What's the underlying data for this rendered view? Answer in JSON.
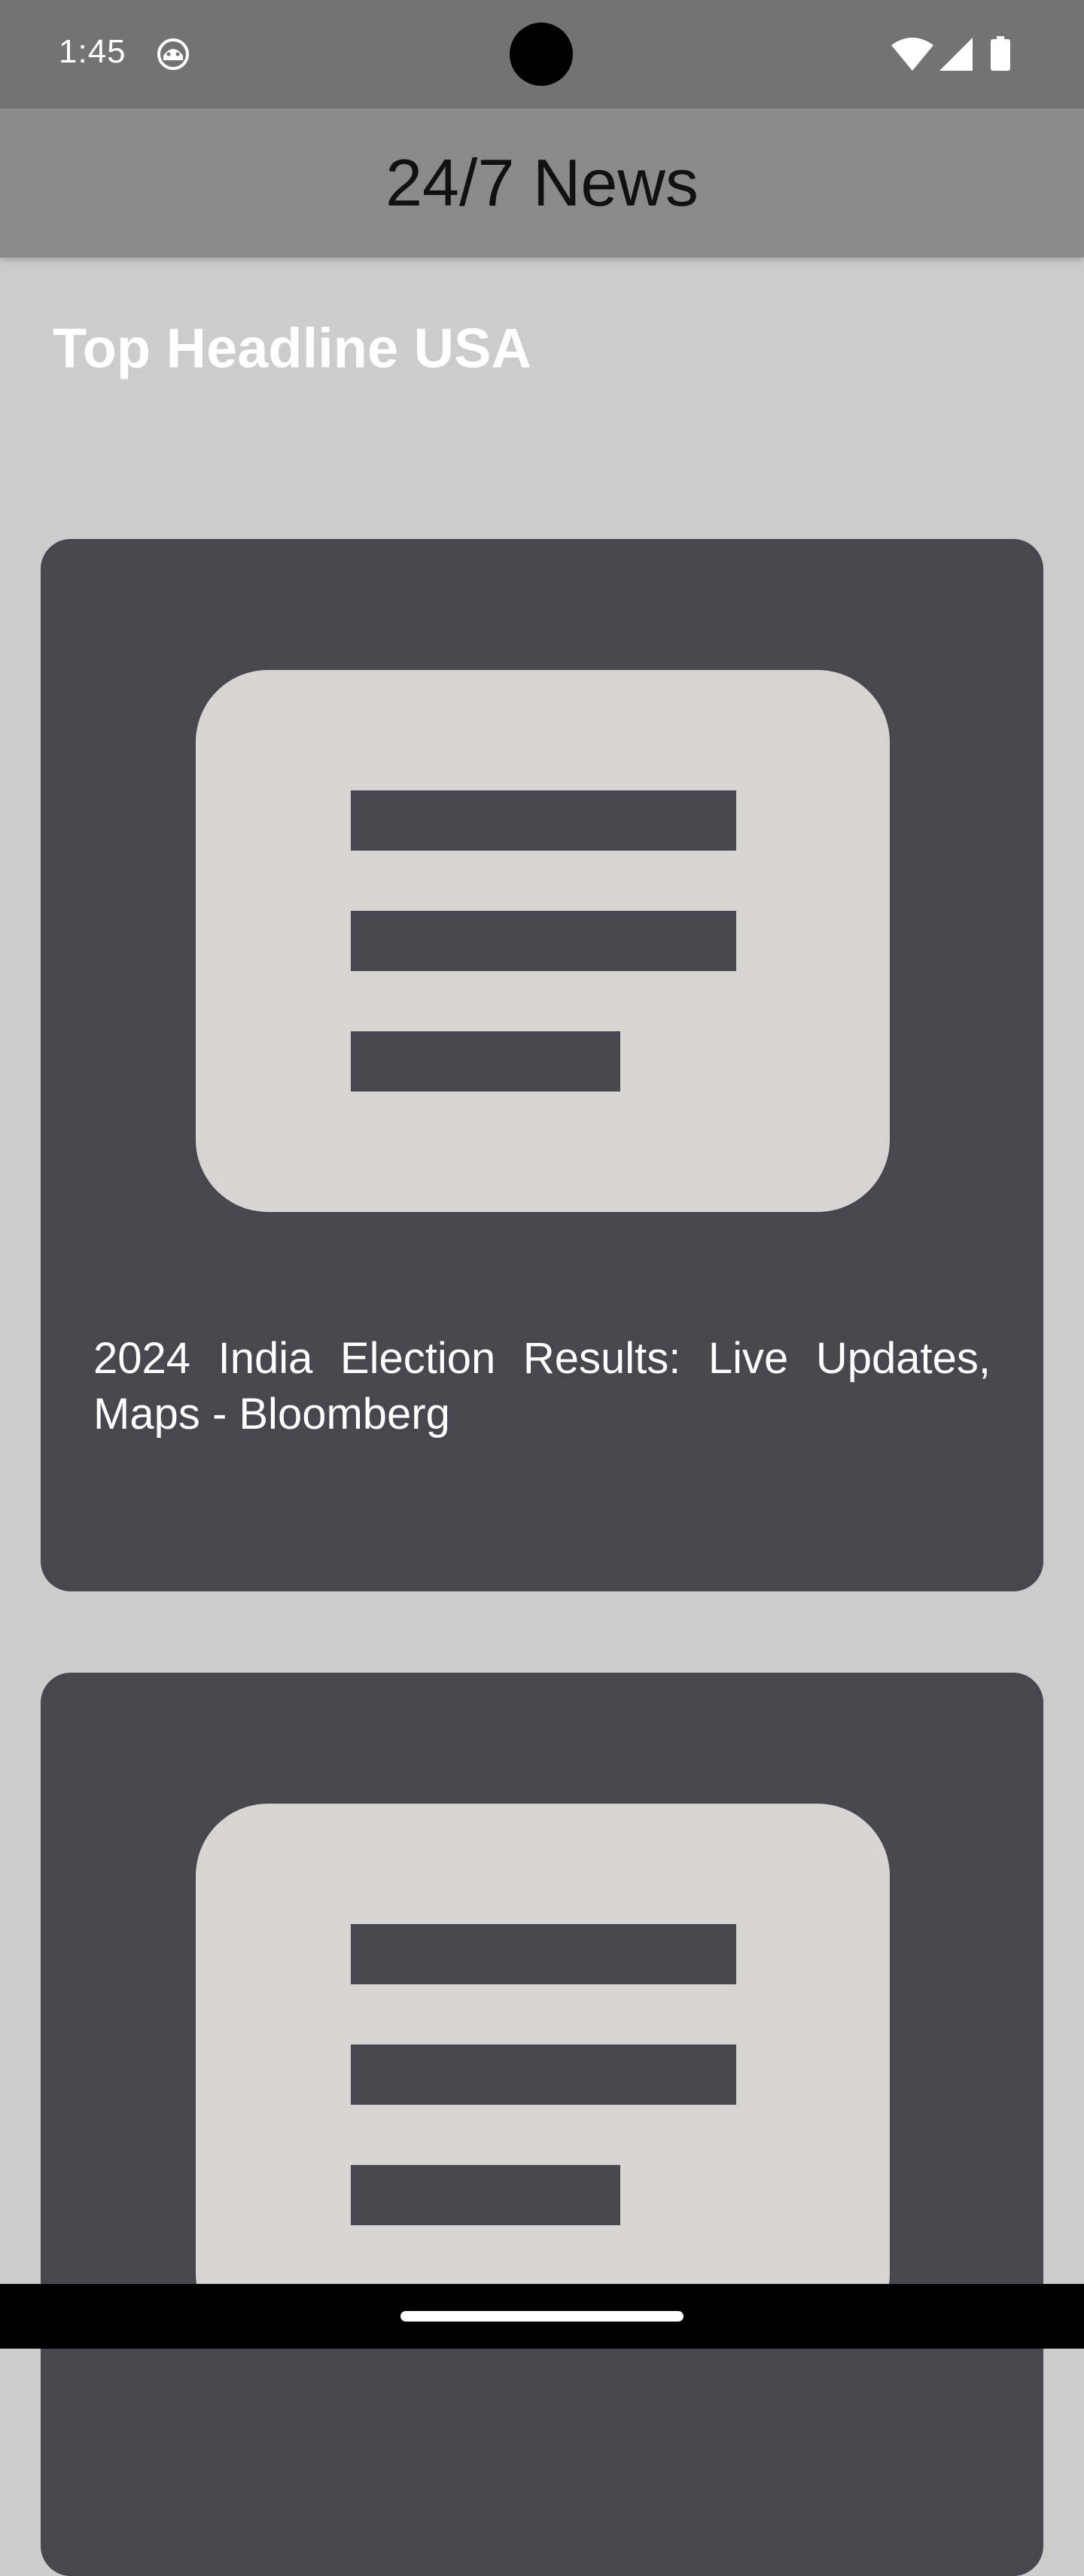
{
  "status_bar": {
    "time": "1:45",
    "app_icon": "android-bot-icon",
    "wifi_icon": "wifi-icon",
    "signal_icon": "cell-signal-icon",
    "battery_icon": "battery-icon"
  },
  "app_bar": {
    "title": "24/7 News"
  },
  "section": {
    "title": "Top Headline USA"
  },
  "articles": [
    {
      "thumbnail_icon": "article-placeholder-icon",
      "headline": "2024 India Election Results: Live Updates, Maps - Bloomberg"
    },
    {
      "thumbnail_icon": "article-placeholder-icon",
      "headline": ""
    }
  ],
  "colors": {
    "status_bar": "#737373",
    "app_bar": "#8a8a8a",
    "background": "#cccccc",
    "card": "#48464f",
    "thumbnail": "#d7d4d4"
  }
}
